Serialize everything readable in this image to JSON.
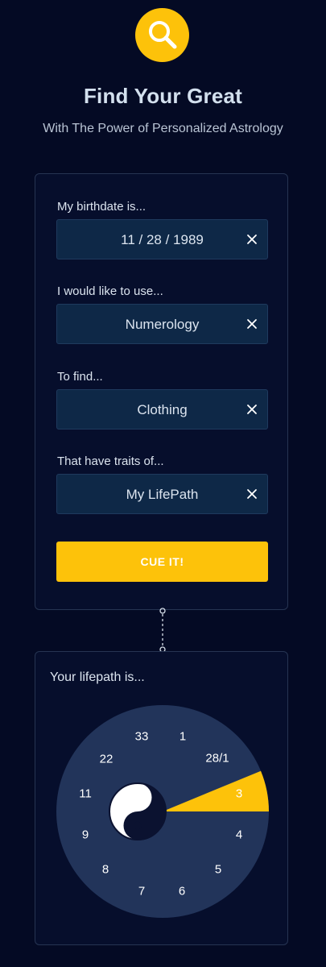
{
  "header": {
    "logo_icon": "search-icon",
    "title": "Find Your Great",
    "subtitle": "With The Power of Personalized Astrology"
  },
  "form": {
    "fields": [
      {
        "label": "My birthdate is...",
        "value": "11 / 28 / 1989",
        "clear_icon": "close-icon"
      },
      {
        "label": "I would like to use...",
        "value": "Numerology",
        "clear_icon": "close-icon"
      },
      {
        "label": "To find...",
        "value": "Clothing",
        "clear_icon": "close-icon"
      },
      {
        "label": "That have traits of...",
        "value": "My LifePath",
        "clear_icon": "close-icon"
      }
    ],
    "submit_label": "CUE IT!"
  },
  "result": {
    "label": "Your lifepath is...",
    "center_icon": "yin-yang-icon",
    "numbers": [
      "1",
      "28/1",
      "3",
      "4",
      "5",
      "6",
      "7",
      "8",
      "9",
      "11",
      "22",
      "33"
    ],
    "selected": "3"
  },
  "colors": {
    "background": "#040a24",
    "card": "#060e2c",
    "field": "#0e2847",
    "accent": "#fdc20a",
    "wheel": "#22345a"
  }
}
